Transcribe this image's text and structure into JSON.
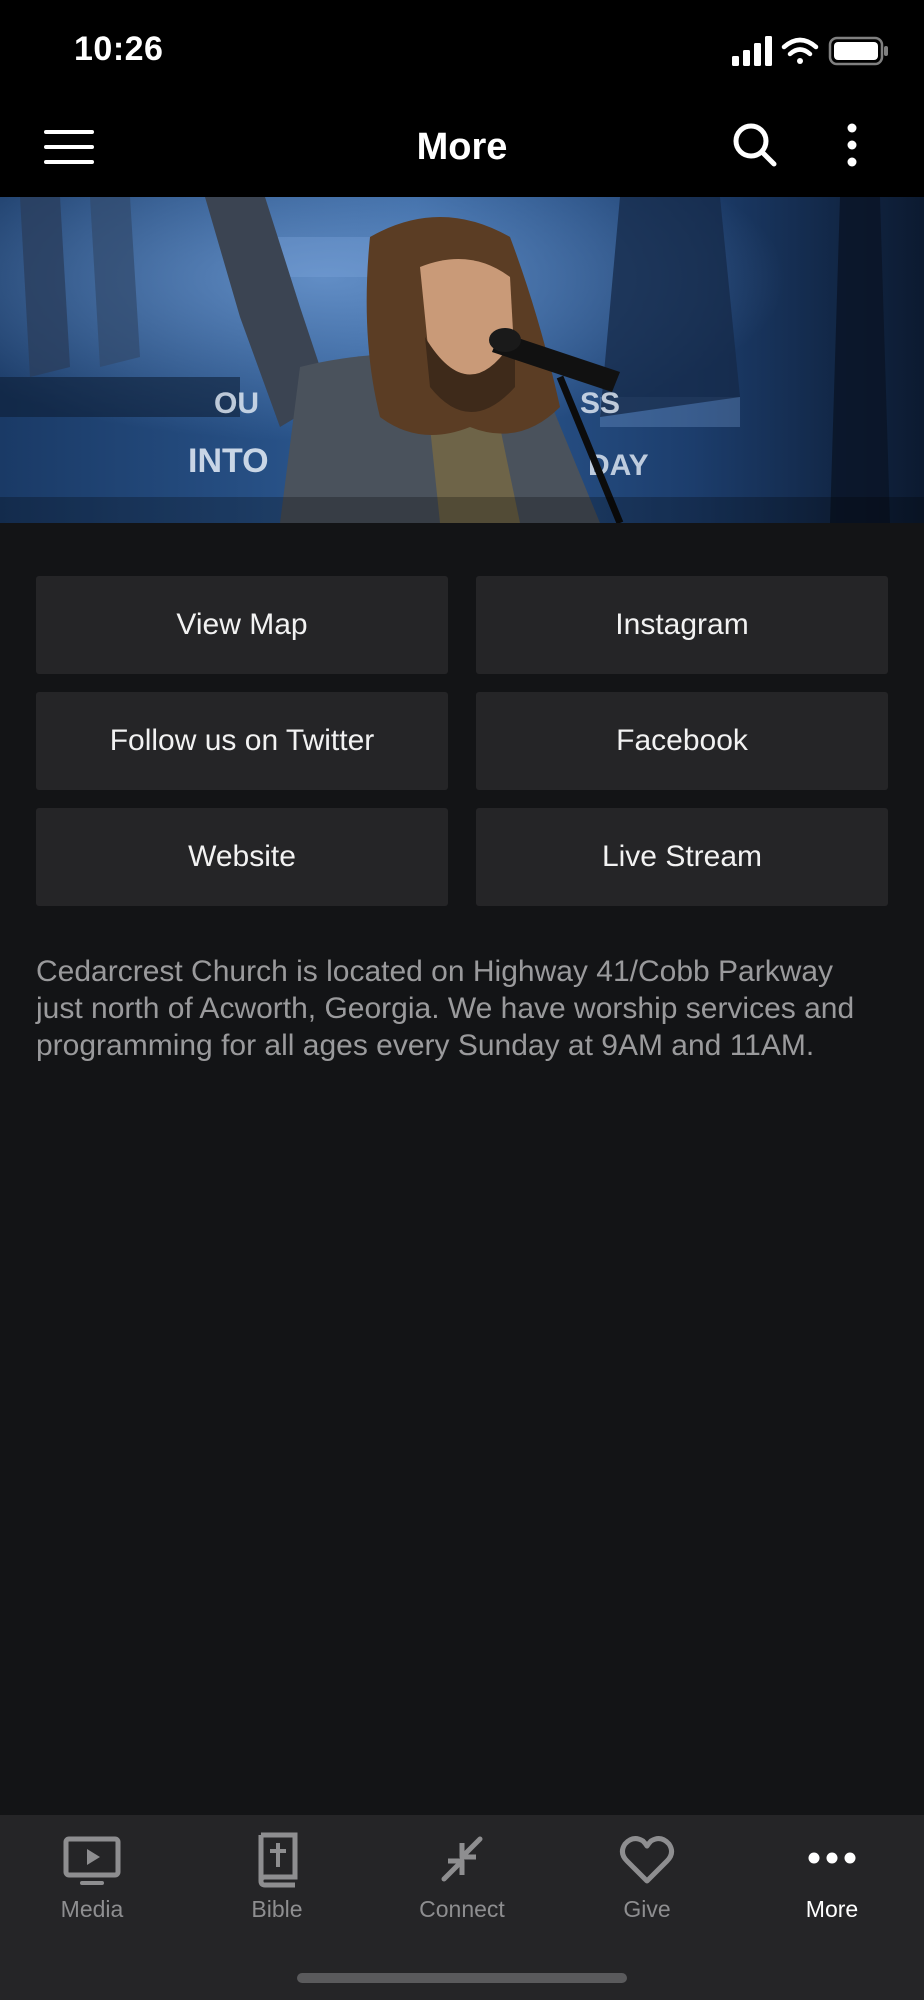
{
  "status_bar": {
    "time": "10:26"
  },
  "header": {
    "title": "More"
  },
  "hero": {
    "banner_text_left": "INTO",
    "banner_text_left_2": "OU",
    "banner_text_right": "SS",
    "banner_text_right_2": "DAY"
  },
  "links": [
    {
      "label": "View Map"
    },
    {
      "label": "Instagram"
    },
    {
      "label": "Follow us on Twitter"
    },
    {
      "label": "Facebook"
    },
    {
      "label": "Website"
    },
    {
      "label": "Live Stream"
    }
  ],
  "description": "Cedarcrest Church is located on Highway 41/Cobb Parkway just north of Acworth, Georgia.  We have worship services and programming for all ages every Sunday at 9AM and 11AM.",
  "tabs": [
    {
      "label": "Media",
      "icon": "tv-play-icon"
    },
    {
      "label": "Bible",
      "icon": "bible-icon"
    },
    {
      "label": "Connect",
      "icon": "connect-arrows-icon"
    },
    {
      "label": "Give",
      "icon": "heart-icon"
    },
    {
      "label": "More",
      "icon": "more-dots-icon",
      "active": true
    }
  ],
  "colors": {
    "background": "#131416",
    "header": "#000000",
    "button": "#252527",
    "tab_bar": "#252527",
    "inactive_tab": "#8e8e90",
    "active_tab": "#ffffff",
    "description_text": "#9a9a9c"
  }
}
